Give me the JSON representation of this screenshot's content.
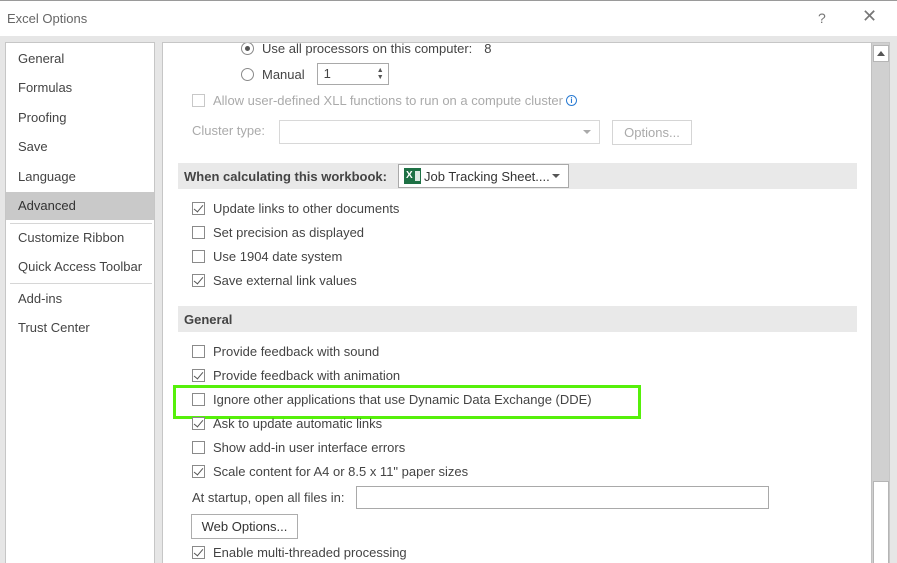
{
  "window": {
    "title": "Excel Options",
    "help_label": "?",
    "close_label": "✕"
  },
  "sidebar": {
    "items": [
      {
        "label": "General",
        "active": false
      },
      {
        "label": "Formulas",
        "active": false
      },
      {
        "label": "Proofing",
        "active": false
      },
      {
        "label": "Save",
        "active": false
      },
      {
        "label": "Language",
        "active": false
      },
      {
        "label": "Advanced",
        "active": true
      },
      {
        "label": "Customize Ribbon",
        "active": false
      },
      {
        "label": "Quick Access Toolbar",
        "active": false
      },
      {
        "label": "Add-ins",
        "active": false
      },
      {
        "label": "Trust Center",
        "active": false
      }
    ]
  },
  "formulas": {
    "use_all_processors": {
      "label": "Use all processors on this computer:",
      "value": "8",
      "checked": true
    },
    "manual": {
      "label": "Manual",
      "value": "1",
      "checked": false
    },
    "allow_xll": {
      "label": "Allow user-defined XLL functions to run on a compute cluster",
      "checked": false,
      "disabled": true
    },
    "cluster_type": {
      "label": "Cluster type:",
      "value": "",
      "disabled": true
    },
    "options_button": "Options..."
  },
  "workbook_section": {
    "heading": "When calculating this workbook:",
    "workbook_select": "Job Tracking Sheet....",
    "workbook_icon": "excel-icon",
    "options": [
      {
        "label": "Update links to other documents",
        "checked": true
      },
      {
        "label": "Set precision as displayed",
        "checked": false
      },
      {
        "label": "Use 1904 date system",
        "checked": false
      },
      {
        "label": "Save external link values",
        "checked": true
      }
    ]
  },
  "general_section": {
    "heading": "General",
    "options": [
      {
        "label": "Provide feedback with sound",
        "checked": false
      },
      {
        "label": "Provide feedback with animation",
        "checked": true
      },
      {
        "label": "Ignore other applications that use Dynamic Data Exchange (DDE)",
        "checked": false,
        "highlighted": true
      },
      {
        "label": "Ask to update automatic links",
        "checked": true
      },
      {
        "label": "Show add-in user interface errors",
        "checked": false
      },
      {
        "label": "Scale content for A4 or 8.5 x 11\" paper sizes",
        "checked": true
      }
    ],
    "startup_label": "At startup, open all files in:",
    "startup_value": "",
    "web_options_button": "Web Options...",
    "multithread": {
      "label": "Enable multi-threaded processing",
      "checked": true
    }
  },
  "colors": {
    "highlight": "#56f00a",
    "excel_green": "#1e7145",
    "active_nav": "#c9c9c9"
  }
}
